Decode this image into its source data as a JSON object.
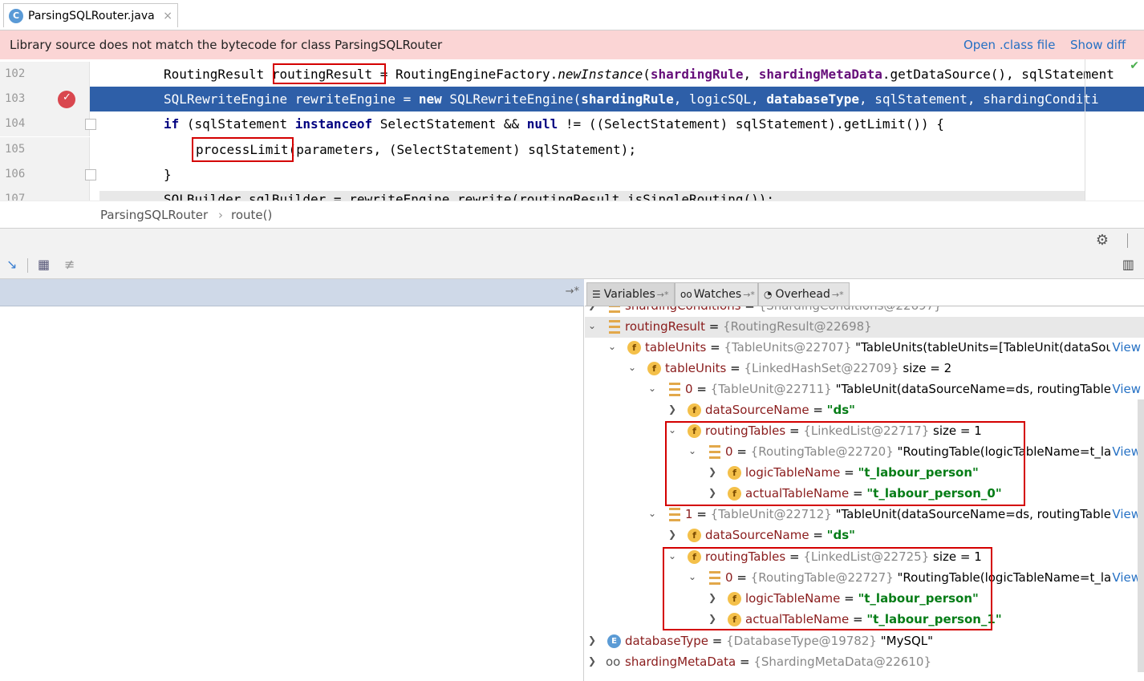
{
  "tab": {
    "title": "ParsingSQLRouter.java",
    "icon": "C",
    "close": "×"
  },
  "banner": {
    "message": "Library source does not match the bytecode for class ParsingSQLRouter",
    "open_class": "Open .class file",
    "show_diff": "Show diff"
  },
  "editor": {
    "lines": [
      {
        "num": "102"
      },
      {
        "num": "103"
      },
      {
        "num": "104"
      },
      {
        "num": "105"
      },
      {
        "num": "106"
      },
      {
        "num": "107"
      }
    ],
    "l102": {
      "a": "RoutingResult ",
      "b": "routingResult",
      "c": " = RoutingEngineFactory.",
      "d": "newInstance",
      "e": "(",
      "f": "shardingRule",
      "g": ", ",
      "h": "shardingMetaData",
      "i": ".getDataSource(), sqlStatement"
    },
    "l103": {
      "a": "SQLRewriteEngine rewriteEngine = ",
      "b": "new",
      "c": " SQLRewriteEngine(",
      "d": "shardingRule",
      "e": ", logicSQL, ",
      "f": "databaseType",
      "g": ", sqlStatement, shardingConditi"
    },
    "l104": {
      "a": "if",
      "b": " (sqlStatement ",
      "c": "instanceof",
      "d": " SelectStatement && ",
      "e": "null",
      "f": " != ((SelectStatement) sqlStatement).getLimit()) {"
    },
    "l105": {
      "a": "processLimit",
      "b": "(parameters, (SelectStatement) sqlStatement);"
    },
    "l106": {
      "a": "}"
    },
    "l107": {
      "a": "SQLBuilder sqlBuilder = rewriteEngine.rewrite(routingResult.isSingleRouting());"
    }
  },
  "breadcrumb": {
    "class": "ParsingSQLRouter",
    "sep": "›",
    "method": "route()"
  },
  "variables": {
    "tabs": {
      "variables": "Variables",
      "watches": "Watches",
      "overhead": "Overhead"
    },
    "rows": [
      {
        "name": "shardingConditions",
        "eq": " = ",
        "type": "{ShardingConditions@22697}"
      },
      {
        "name": "routingResult",
        "eq": " = ",
        "type": "{RoutingResult@22698}"
      },
      {
        "name": "tableUnits",
        "eq": " = ",
        "type": "{TableUnits@22707}",
        "value": " \"TableUnits(tableUnits=[TableUnit(dataSour...",
        "view": "View"
      },
      {
        "name": "tableUnits",
        "eq": " = ",
        "type": "{LinkedHashSet@22709}",
        "value": "  size = 2"
      },
      {
        "name": "0",
        "eq": " = ",
        "type": "{TableUnit@22711}",
        "value": " \"TableUnit(dataSourceName=ds, routingTables...",
        "view": "View"
      },
      {
        "name": "dataSourceName",
        "eq": " = ",
        "value": "\"ds\""
      },
      {
        "name": "routingTables",
        "eq": " = ",
        "type": "{LinkedList@22717}",
        "value": "  size = 1"
      },
      {
        "name": "0",
        "eq": " = ",
        "type": "{RoutingTable@22720}",
        "value": " \"RoutingTable(logicTableName=t_la...",
        "view": "View"
      },
      {
        "name": "logicTableName",
        "eq": " = ",
        "value": "\"t_labour_person\""
      },
      {
        "name": "actualTableName",
        "eq": " = ",
        "value": "\"t_labour_person_0\""
      },
      {
        "name": "1",
        "eq": " = ",
        "type": "{TableUnit@22712}",
        "value": " \"TableUnit(dataSourceName=ds, routingTables...",
        "view": "View"
      },
      {
        "name": "dataSourceName",
        "eq": " = ",
        "value": "\"ds\""
      },
      {
        "name": "routingTables",
        "eq": " = ",
        "type": "{LinkedList@22725}",
        "value": "  size = 1"
      },
      {
        "name": "0",
        "eq": " = ",
        "type": "{RoutingTable@22727}",
        "value": " \"RoutingTable(logicTableName=t_la...",
        "view": "View"
      },
      {
        "name": "logicTableName",
        "eq": " = ",
        "value": "\"t_labour_person\""
      },
      {
        "name": "actualTableName",
        "eq": " = ",
        "value": "\"t_labour_person_1\""
      },
      {
        "name": "databaseType",
        "eq": " = ",
        "type": "{DatabaseType@19782}",
        "value": " \"MySQL\""
      },
      {
        "name": "shardingMetaData",
        "eq": " = ",
        "type": "{ShardingMetaData@22610}"
      }
    ]
  },
  "colors": {
    "highlight": "#2e5fa8",
    "banner": "#fbd5d5",
    "link": "#2470c4",
    "redbox": "#d40000"
  }
}
